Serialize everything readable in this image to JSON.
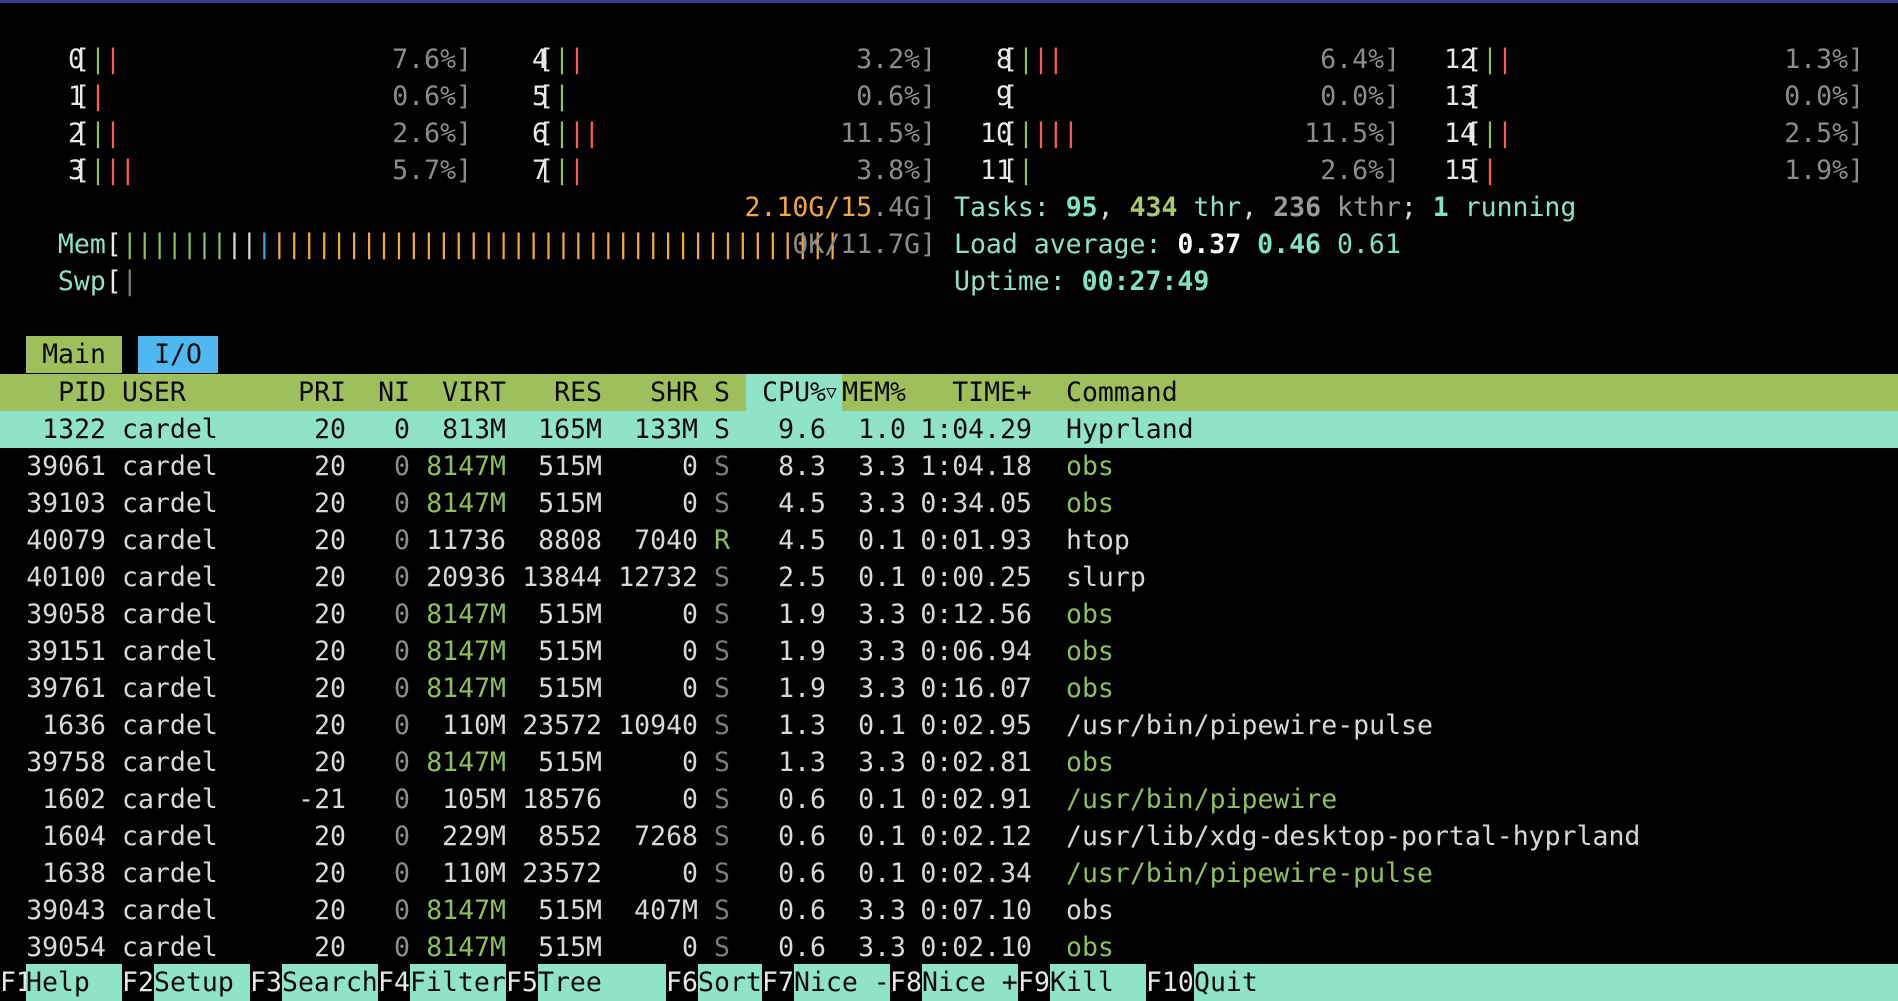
{
  "cpus": [
    {
      "id": "0",
      "bars": [
        [
          "g",
          "|"
        ],
        [
          "r",
          "|"
        ]
      ],
      "pct": "7.6%]"
    },
    {
      "id": "1",
      "bars": [
        [
          "r",
          "|"
        ]
      ],
      "pct": "0.6%]"
    },
    {
      "id": "2",
      "bars": [
        [
          "g",
          "|"
        ],
        [
          "r",
          "|"
        ]
      ],
      "pct": "2.6%]"
    },
    {
      "id": "3",
      "bars": [
        [
          "g",
          "|"
        ],
        [
          "r",
          "||"
        ]
      ],
      "pct": "5.7%]"
    },
    {
      "id": "4",
      "bars": [
        [
          "g",
          "|"
        ],
        [
          "r",
          "|"
        ]
      ],
      "pct": "3.2%]"
    },
    {
      "id": "5",
      "bars": [
        [
          "g",
          "|"
        ]
      ],
      "pct": "0.6%]"
    },
    {
      "id": "6",
      "bars": [
        [
          "g",
          "|"
        ],
        [
          "r",
          "||"
        ]
      ],
      "pct": "11.5%]"
    },
    {
      "id": "7",
      "bars": [
        [
          "g",
          "|"
        ],
        [
          "r",
          "|"
        ]
      ],
      "pct": "3.8%]"
    },
    {
      "id": "8",
      "bars": [
        [
          "g",
          "|"
        ],
        [
          "r",
          "||"
        ]
      ],
      "pct": "6.4%]"
    },
    {
      "id": "9",
      "bars": [],
      "pct": "0.0%]"
    },
    {
      "id": "10",
      "bars": [
        [
          "g",
          "|"
        ],
        [
          "r",
          "|||"
        ]
      ],
      "pct": "11.5%]"
    },
    {
      "id": "11",
      "bars": [
        [
          "g",
          "|"
        ]
      ],
      "pct": "2.6%]"
    },
    {
      "id": "12",
      "bars": [
        [
          "g",
          "|"
        ],
        [
          "r",
          "|"
        ]
      ],
      "pct": "1.3%]"
    },
    {
      "id": "13",
      "bars": [],
      "pct": "0.0%]"
    },
    {
      "id": "14",
      "bars": [
        [
          "g",
          "|"
        ],
        [
          "r",
          "|"
        ]
      ],
      "pct": "2.5%]"
    },
    {
      "id": "15",
      "bars": [
        [
          "r",
          "|"
        ]
      ],
      "pct": "1.9%]"
    }
  ],
  "mem": {
    "label": "Mem",
    "bars": [
      [
        "g",
        "|||||||"
      ],
      [
        "w",
        "||"
      ],
      [
        "b",
        "|"
      ],
      [
        "o",
        "||||||||||||||||||||||||||||||||||||||"
      ]
    ],
    "value_hi": "2.10G/15",
    "value_lo": ".4G]"
  },
  "swp": {
    "label": "Swp",
    "bars": [
      [
        "dim",
        "|"
      ]
    ],
    "value": "0K/11.7G]"
  },
  "tasks": {
    "label": "Tasks: ",
    "count": "95",
    "sep1": ", ",
    "thr": "434",
    "thr_label": " thr",
    "sep2": ", ",
    "kthr": "236",
    "kthr_label": " kthr",
    "sep3": "; ",
    "running": "1",
    "running_label": " running"
  },
  "load": {
    "label": "Load average: ",
    "l1": "0.37",
    "l5": "0.46",
    "l15": "0.61"
  },
  "uptime": {
    "label": "Uptime: ",
    "value": "00:27:49"
  },
  "tabs": {
    "main": "Main",
    "io": "I/O"
  },
  "columns": {
    "pid": "PID",
    "user": "USER",
    "pri": "PRI",
    "ni": "NI",
    "virt": "VIRT",
    "res": "RES",
    "shr": "SHR",
    "s": "S",
    "cpu": "CPU%",
    "sort_indicator": "▽",
    "mem": "MEM%",
    "time": "TIME+",
    "command": "Command"
  },
  "processes": [
    {
      "pid": "1322",
      "user": "cardel",
      "pri": "20",
      "ni": "0",
      "virt": "813M",
      "res": "165M",
      "shr": "133M",
      "s": "S",
      "cpu": "9.6",
      "mem": "1.0",
      "time": "1:04.29",
      "cmd": "Hyprland",
      "cmdc": "w",
      "virtc": "w",
      "sc": "w",
      "sel": true
    },
    {
      "pid": "39061",
      "user": "cardel",
      "pri": "20",
      "ni": "0",
      "virt": "8147M",
      "res": "515M",
      "shr": "0",
      "s": "S",
      "cpu": "8.3",
      "mem": "3.3",
      "time": "1:04.18",
      "cmd": "obs",
      "cmdc": "g",
      "virtc": "g",
      "sc": "dim"
    },
    {
      "pid": "39103",
      "user": "cardel",
      "pri": "20",
      "ni": "0",
      "virt": "8147M",
      "res": "515M",
      "shr": "0",
      "s": "S",
      "cpu": "4.5",
      "mem": "3.3",
      "time": "0:34.05",
      "cmd": "obs",
      "cmdc": "g",
      "virtc": "g",
      "sc": "dim"
    },
    {
      "pid": "40079",
      "user": "cardel",
      "pri": "20",
      "ni": "0",
      "virt": "11736",
      "res": "8808",
      "shr": "7040",
      "s": "R",
      "cpu": "4.5",
      "mem": "0.1",
      "time": "0:01.93",
      "cmd": "htop",
      "cmdc": "w",
      "virtc": "w",
      "sc": "g"
    },
    {
      "pid": "40100",
      "user": "cardel",
      "pri": "20",
      "ni": "0",
      "virt": "20936",
      "res": "13844",
      "shr": "12732",
      "s": "S",
      "cpu": "2.5",
      "mem": "0.1",
      "time": "0:00.25",
      "cmd": "slurp",
      "cmdc": "w",
      "virtc": "w",
      "sc": "dim"
    },
    {
      "pid": "39058",
      "user": "cardel",
      "pri": "20",
      "ni": "0",
      "virt": "8147M",
      "res": "515M",
      "shr": "0",
      "s": "S",
      "cpu": "1.9",
      "mem": "3.3",
      "time": "0:12.56",
      "cmd": "obs",
      "cmdc": "g",
      "virtc": "g",
      "sc": "dim"
    },
    {
      "pid": "39151",
      "user": "cardel",
      "pri": "20",
      "ni": "0",
      "virt": "8147M",
      "res": "515M",
      "shr": "0",
      "s": "S",
      "cpu": "1.9",
      "mem": "3.3",
      "time": "0:06.94",
      "cmd": "obs",
      "cmdc": "g",
      "virtc": "g",
      "sc": "dim"
    },
    {
      "pid": "39761",
      "user": "cardel",
      "pri": "20",
      "ni": "0",
      "virt": "8147M",
      "res": "515M",
      "shr": "0",
      "s": "S",
      "cpu": "1.9",
      "mem": "3.3",
      "time": "0:16.07",
      "cmd": "obs",
      "cmdc": "g",
      "virtc": "g",
      "sc": "dim"
    },
    {
      "pid": "1636",
      "user": "cardel",
      "pri": "20",
      "ni": "0",
      "virt": "110M",
      "res": "23572",
      "shr": "10940",
      "s": "S",
      "cpu": "1.3",
      "mem": "0.1",
      "time": "0:02.95",
      "cmd": "/usr/bin/pipewire-pulse",
      "cmdc": "w",
      "virtc": "w",
      "sc": "dim"
    },
    {
      "pid": "39758",
      "user": "cardel",
      "pri": "20",
      "ni": "0",
      "virt": "8147M",
      "res": "515M",
      "shr": "0",
      "s": "S",
      "cpu": "1.3",
      "mem": "3.3",
      "time": "0:02.81",
      "cmd": "obs",
      "cmdc": "g",
      "virtc": "g",
      "sc": "dim"
    },
    {
      "pid": "1602",
      "user": "cardel",
      "pri": "-21",
      "ni": "0",
      "virt": "105M",
      "res": "18576",
      "shr": "0",
      "s": "S",
      "cpu": "0.6",
      "mem": "0.1",
      "time": "0:02.91",
      "cmd": "/usr/bin/pipewire",
      "cmdc": "g",
      "virtc": "w",
      "sc": "dim"
    },
    {
      "pid": "1604",
      "user": "cardel",
      "pri": "20",
      "ni": "0",
      "virt": "229M",
      "res": "8552",
      "shr": "7268",
      "s": "S",
      "cpu": "0.6",
      "mem": "0.1",
      "time": "0:02.12",
      "cmd": "/usr/lib/xdg-desktop-portal-hyprland",
      "cmdc": "w",
      "virtc": "w",
      "sc": "dim"
    },
    {
      "pid": "1638",
      "user": "cardel",
      "pri": "20",
      "ni": "0",
      "virt": "110M",
      "res": "23572",
      "shr": "0",
      "s": "S",
      "cpu": "0.6",
      "mem": "0.1",
      "time": "0:02.34",
      "cmd": "/usr/bin/pipewire-pulse",
      "cmdc": "g",
      "virtc": "w",
      "sc": "dim"
    },
    {
      "pid": "39043",
      "user": "cardel",
      "pri": "20",
      "ni": "0",
      "virt": "8147M",
      "res": "515M",
      "shr": "407M",
      "s": "S",
      "cpu": "0.6",
      "mem": "3.3",
      "time": "0:07.10",
      "cmd": "obs",
      "cmdc": "w",
      "virtc": "g",
      "sc": "dim"
    },
    {
      "pid": "39054",
      "user": "cardel",
      "pri": "20",
      "ni": "0",
      "virt": "8147M",
      "res": "515M",
      "shr": "0",
      "s": "S",
      "cpu": "0.6",
      "mem": "3.3",
      "time": "0:02.10",
      "cmd": "obs",
      "cmdc": "g",
      "virtc": "g",
      "sc": "dim"
    }
  ],
  "fkeys": [
    {
      "key": "F1",
      "label": "Help"
    },
    {
      "key": "F2",
      "label": "Setup"
    },
    {
      "key": "F3",
      "label": "Search"
    },
    {
      "key": "F4",
      "label": "Filter"
    },
    {
      "key": "F5",
      "label": "Tree"
    },
    {
      "key": "F6",
      "label": "SortBy"
    },
    {
      "key": "F7",
      "label": "Nice -"
    },
    {
      "key": "F8",
      "label": "Nice +"
    },
    {
      "key": "F9",
      "label": "Kill"
    },
    {
      "key": "F10",
      "label": "Quit"
    }
  ]
}
